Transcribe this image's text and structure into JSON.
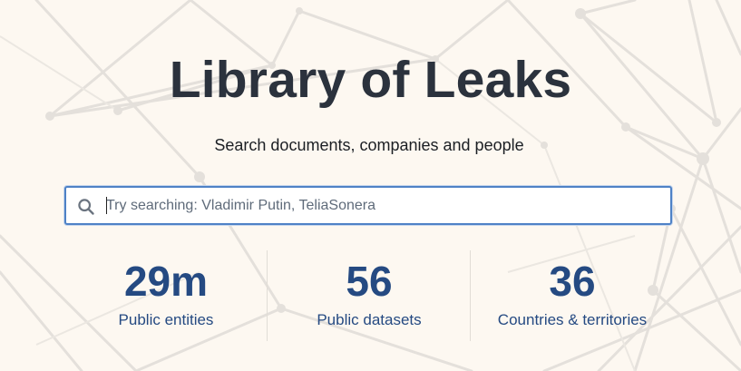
{
  "header": {
    "title": "Library of Leaks",
    "subtitle": "Search documents, companies and people"
  },
  "search": {
    "placeholder": "Try searching: Vladimir Putin, TeliaSonera",
    "value": "",
    "icon": "search-icon"
  },
  "stats": [
    {
      "value": "29m",
      "label": "Public entities"
    },
    {
      "value": "56",
      "label": "Public datasets"
    },
    {
      "value": "36",
      "label": "Countries & territories"
    }
  ],
  "colors": {
    "background": "#fdf8f1",
    "title": "#2b323d",
    "accent": "#254a82",
    "search_border": "#4f82c6"
  }
}
